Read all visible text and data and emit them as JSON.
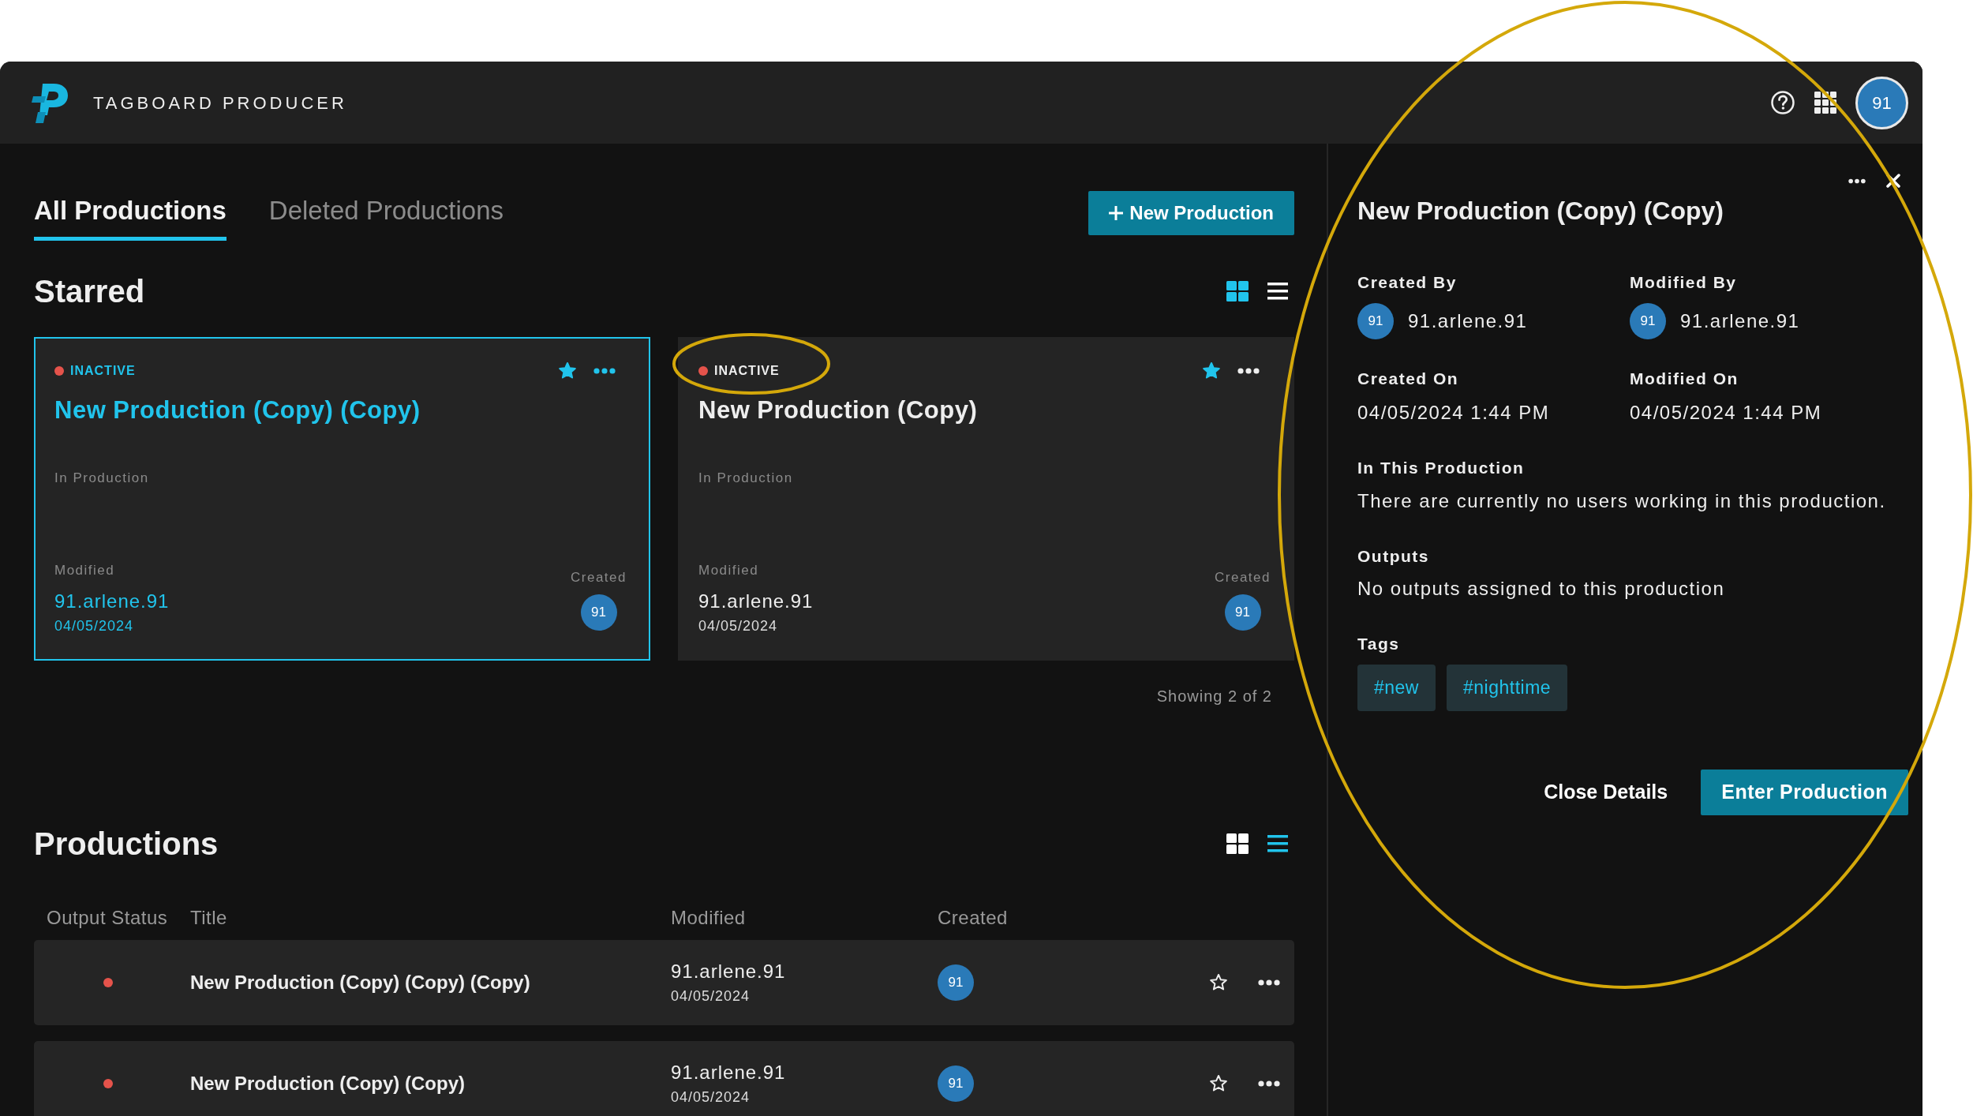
{
  "app": {
    "title": "TAGBOARD PRODUCER",
    "user_initials": "91"
  },
  "tabs": [
    {
      "label": "All Productions",
      "selected": true
    },
    {
      "label": "Deleted Productions",
      "selected": false
    }
  ],
  "new_button": "New Production",
  "starred": {
    "title": "Starred",
    "view_options": [
      {
        "kind": "grid",
        "selected": true
      },
      {
        "kind": "list",
        "selected": false
      }
    ],
    "cards": [
      {
        "status": "INACTIVE",
        "active": false,
        "title": "New Production (Copy) (Copy)",
        "selected": true,
        "starred": true,
        "section_label": "In Production",
        "modified_label": "Modified",
        "modified_by": "91.arlene.91",
        "modified_date": "04/05/2024",
        "created_label": "Created",
        "created_initials": "91"
      },
      {
        "status": "INACTIVE",
        "active": false,
        "title": "New Production (Copy)",
        "selected": false,
        "starred": true,
        "section_label": "In Production",
        "modified_label": "Modified",
        "modified_by": "91.arlene.91",
        "modified_date": "04/05/2024",
        "created_label": "Created",
        "created_initials": "91"
      }
    ],
    "footer": "Showing 2 of 2"
  },
  "productions": {
    "title": "Productions",
    "view_options": [
      {
        "kind": "grid",
        "selected": false
      },
      {
        "kind": "list",
        "selected": true
      }
    ],
    "columns": [
      "Output Status",
      "Title",
      "Modified",
      "Created"
    ],
    "rows": [
      {
        "active": false,
        "title": "New Production (Copy) (Copy) (Copy)",
        "modified_by": "91.arlene.91",
        "modified_date": "04/05/2024",
        "created_initials": "91",
        "starred": false
      },
      {
        "active": false,
        "title": "New Production (Copy) (Copy)",
        "modified_by": "91.arlene.91",
        "modified_date": "04/05/2024",
        "created_initials": "91",
        "starred": false
      }
    ]
  },
  "details": {
    "title": "New Production (Copy) (Copy)",
    "meta": [
      {
        "label": "Created By",
        "kind": "user",
        "initials": "91",
        "value": "91.arlene.91"
      },
      {
        "label": "Modified By",
        "kind": "user",
        "initials": "91",
        "value": "91.arlene.91"
      },
      {
        "label": "Created On",
        "kind": "text",
        "value": "04/05/2024 1:44 PM"
      },
      {
        "label": "Modified On",
        "kind": "text",
        "value": "04/05/2024 1:44 PM"
      }
    ],
    "sections": [
      {
        "label": "In This Production",
        "text": "There are currently no users working in this production."
      },
      {
        "label": "Outputs",
        "text": "No outputs assigned to this production"
      }
    ],
    "tags_label": "Tags",
    "tags": [
      "#new",
      "#nighttime"
    ],
    "close_label": "Close Details",
    "enter_label": "Enter Production"
  },
  "annotations": [
    {
      "kind": "ellipse"
    },
    {
      "kind": "ellipse"
    }
  ]
}
